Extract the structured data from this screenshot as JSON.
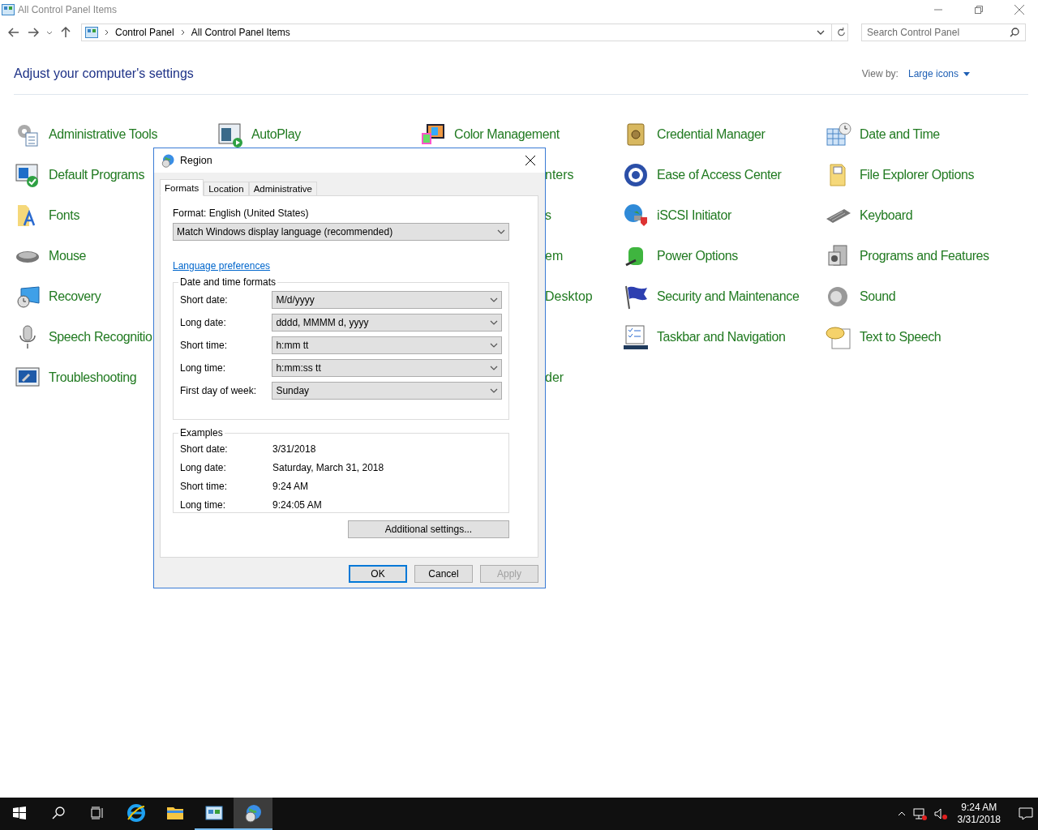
{
  "window": {
    "title": "All Control Panel Items"
  },
  "address_bar": {
    "crumbs": [
      "Control Panel",
      "All Control Panel Items"
    ]
  },
  "search": {
    "placeholder": "Search Control Panel"
  },
  "heading": "Adjust your computer's settings",
  "view_by": {
    "label": "View by:",
    "value": "Large icons"
  },
  "items": [
    [
      {
        "kind": "full",
        "label": "Administrative Tools"
      },
      {
        "kind": "full",
        "label": "AutoPlay"
      },
      {
        "kind": "full",
        "label": "Color Management"
      },
      {
        "kind": "full",
        "label": "Credential Manager"
      },
      {
        "kind": "full",
        "label": "Date and Time"
      }
    ],
    [
      {
        "kind": "full",
        "label": "Default Programs"
      },
      {
        "kind": "covered"
      },
      {
        "kind": "cut",
        "label": "nters"
      },
      {
        "kind": "full",
        "label": "Ease of Access Center"
      },
      {
        "kind": "full",
        "label": "File Explorer Options"
      }
    ],
    [
      {
        "kind": "full",
        "label": "Fonts"
      },
      {
        "kind": "covered"
      },
      {
        "kind": "cut",
        "label": "s"
      },
      {
        "kind": "full",
        "label": "iSCSI Initiator"
      },
      {
        "kind": "full",
        "label": "Keyboard"
      }
    ],
    [
      {
        "kind": "full",
        "label": "Mouse"
      },
      {
        "kind": "covered"
      },
      {
        "kind": "cut",
        "label": "em"
      },
      {
        "kind": "full",
        "label": "Power Options"
      },
      {
        "kind": "full",
        "label": "Programs and Features"
      }
    ],
    [
      {
        "kind": "full",
        "label": "Recovery"
      },
      {
        "kind": "covered"
      },
      {
        "kind": "cut",
        "label": "Desktop"
      },
      {
        "kind": "full",
        "label": "Security and Maintenance"
      },
      {
        "kind": "full",
        "label": "Sound"
      }
    ],
    [
      {
        "kind": "full",
        "label": "Speech Recognitio"
      },
      {
        "kind": "covered"
      },
      {
        "kind": "covered"
      },
      {
        "kind": "full",
        "label": "Taskbar and Navigation"
      },
      {
        "kind": "full",
        "label": "Text to Speech"
      }
    ],
    [
      {
        "kind": "full",
        "label": "Troubleshooting"
      },
      {
        "kind": "covered"
      },
      {
        "kind": "cut",
        "label": "der"
      }
    ]
  ],
  "dialog": {
    "title": "Region",
    "tabs": [
      {
        "label": "Formats",
        "selected": true
      },
      {
        "label": "Location",
        "selected": false
      },
      {
        "label": "Administrative",
        "selected": false
      }
    ],
    "format_label": "Format: English (United States)",
    "format_value": "Match Windows display language (recommended)",
    "link": "Language preferences",
    "formats_group": {
      "title": "Date and time formats",
      "rows": [
        {
          "label": "Short date:",
          "value": "M/d/yyyy"
        },
        {
          "label": "Long date:",
          "value": "dddd, MMMM d, yyyy"
        },
        {
          "label": "Short time:",
          "value": "h:mm tt"
        },
        {
          "label": "Long time:",
          "value": "h:mm:ss tt"
        },
        {
          "label": "First day of week:",
          "value": "Sunday"
        }
      ]
    },
    "examples": {
      "title": "Examples",
      "rows": [
        {
          "label": "Short date:",
          "value": "3/31/2018"
        },
        {
          "label": "Long date:",
          "value": "Saturday, March 31, 2018"
        },
        {
          "label": "Short time:",
          "value": "9:24 AM"
        },
        {
          "label": "Long time:",
          "value": "9:24:05 AM"
        }
      ]
    },
    "additional_button": "Additional settings...",
    "buttons": [
      {
        "label": "OK",
        "default": true,
        "disabled": false
      },
      {
        "label": "Cancel",
        "default": false,
        "disabled": false
      },
      {
        "label": "Apply",
        "default": false,
        "disabled": true
      }
    ]
  },
  "taskbar": {
    "apps": [
      {
        "running": false,
        "focused": false
      },
      {
        "running": false,
        "focused": false
      },
      {
        "running": true,
        "focused": false
      },
      {
        "running": true,
        "focused": true
      }
    ],
    "time": "9:24 AM",
    "date": "3/31/2018"
  }
}
